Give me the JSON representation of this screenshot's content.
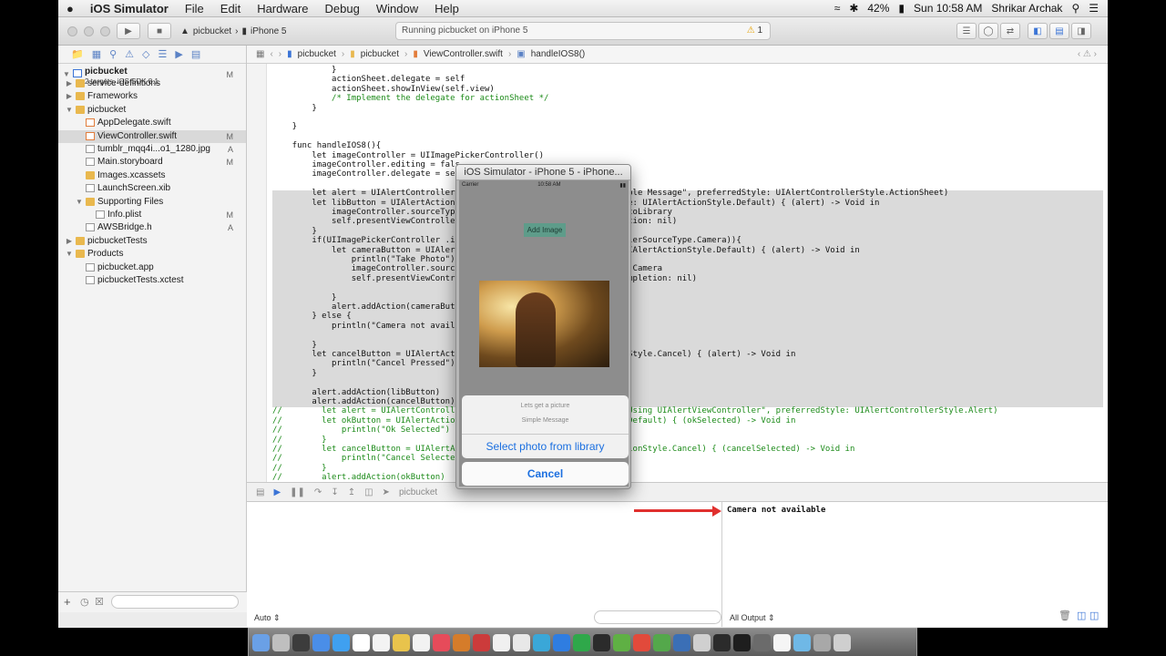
{
  "menubar": {
    "apple": "",
    "app": "iOS Simulator",
    "items": [
      "File",
      "Edit",
      "Hardware",
      "Debug",
      "Window",
      "Help"
    ],
    "battery": "42%",
    "clock": "Sun 10:58 AM",
    "user": "Shrikar Archak"
  },
  "toolbar": {
    "scheme_project": "picbucket",
    "scheme_device": "iPhone 5",
    "activity": "Running picbucket on iPhone 5",
    "warnings": "1"
  },
  "navigator": {
    "project": "picbucket",
    "project_sub": "2 targets, iOS SDK 8.1",
    "project_badge": "M",
    "items": [
      {
        "label": "service-definitions",
        "badge": ""
      },
      {
        "label": "Frameworks",
        "badge": ""
      },
      {
        "label": "picbucket",
        "badge": ""
      },
      {
        "label": "AppDelegate.swift",
        "badge": ""
      },
      {
        "label": "ViewController.swift",
        "badge": "M"
      },
      {
        "label": "tumblr_mqq4i...o1_1280.jpg",
        "badge": "A"
      },
      {
        "label": "Main.storyboard",
        "badge": "M"
      },
      {
        "label": "Images.xcassets",
        "badge": ""
      },
      {
        "label": "LaunchScreen.xib",
        "badge": ""
      },
      {
        "label": "Supporting Files",
        "badge": ""
      },
      {
        "label": "Info.plist",
        "badge": "M"
      },
      {
        "label": "AWSBridge.h",
        "badge": "A"
      },
      {
        "label": "picbucketTests",
        "badge": ""
      },
      {
        "label": "Products",
        "badge": ""
      },
      {
        "label": "picbucket.app",
        "badge": ""
      },
      {
        "label": "picbucketTests.xctest",
        "badge": ""
      }
    ]
  },
  "jumpbar": {
    "crumbs": [
      "picbucket",
      "picbucket",
      "ViewController.swift",
      "handleIOS8()"
    ]
  },
  "debugbar": {
    "target": "picbucket"
  },
  "console": {
    "output": "Camera not available",
    "auto_label": "Auto",
    "output_label": "All Output"
  },
  "simulator": {
    "title": "iOS Simulator - iPhone 5 - iPhone...",
    "carrier": "Carrier",
    "time": "10:58 AM",
    "add_image": "Add Image",
    "sheet_title": "Lets get a picture",
    "sheet_message": "Simple Message",
    "select_photo": "Select photo from library",
    "cancel": "Cancel"
  },
  "code_lines": [
    "            }",
    "            actionSheet.delegate = self",
    "            actionSheet.showInView(self.view)",
    "            /* Implement the delegate for actionSheet */",
    "        }",
    "",
    "    }",
    "",
    "    func handleIOS8(){",
    "        let imageController = UIImagePickerController()",
    "        imageController.editing = fals",
    "        imageController.delegate = sel",
    "",
    "        let alert = UIAlertController(                              \"Simple Message\", preferredStyle: UIAlertControllerStyle.ActionSheet)",
    "        let libButton = UIAlertAction(                              style: UIAlertActionStyle.Default) { (alert) -> Void in",
    "            imageController.sourceType                              .PhotoLibrary",
    "            self.presentViewController                              mpletion: nil)",
    "        }",
    "        if(UIImagePickerController .is                              trollerSourceType.Camera)){",
    "            let cameraButton = UIAlert                              e: UIAlertActionStyle.Default) { (alert) -> Void in",
    "                println(\"Take Photo\")",
    "                imageController.source                              Type.Camera",
    "                self.presentViewContro                              , completion: nil)",
    "",
    "            }",
    "            alert.addAction(cameraButt",
    "        } else {",
    "            println(\"Camera not availa",
    "",
    "        }",
    "        let cancelButton = UIAlertActi                              tionStyle.Cancel) { (alert) -> Void in",
    "            println(\"Cancel Pressed\")",
    "        }",
    "",
    "        alert.addAction(libButton)",
    "        alert.addAction(cancelButton)",
    "//        let alert = UIAlertControlle                              e: \"Using UIAlertViewController\", preferredStyle: UIAlertControllerStyle.Alert)",
    "//        let okButton = UIAlertAction                              yle.Default) { (okSelected) -> Void in",
    "//            println(\"Ok Selected\")",
    "//        }",
    "//        let cancelButton = UIAlertAct                              ActionStyle.Cancel) { (cancelSelected) -> Void in",
    "//            println(\"Cancel Selected",
    "//        }",
    "//        alert.addAction(okButton)"
  ],
  "colors": {
    "accent": "#1b6fe0",
    "arrow": "#e0302e",
    "selection": "#dadada"
  }
}
